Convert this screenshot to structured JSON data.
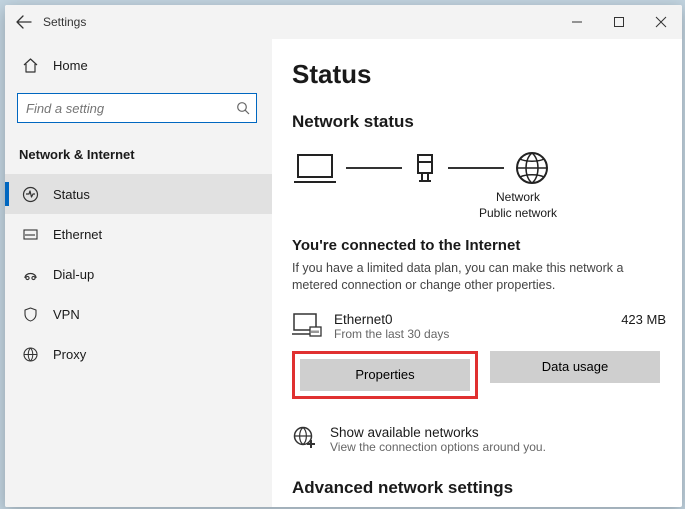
{
  "window": {
    "title": "Settings"
  },
  "sidebar": {
    "home_label": "Home",
    "search_placeholder": "Find a setting",
    "category_label": "Network & Internet",
    "items": [
      {
        "label": "Status"
      },
      {
        "label": "Ethernet"
      },
      {
        "label": "Dial-up"
      },
      {
        "label": "VPN"
      },
      {
        "label": "Proxy"
      }
    ]
  },
  "content": {
    "page_title": "Status",
    "section_title": "Network status",
    "diagram": {
      "label_line1": "Network",
      "label_line2": "Public network"
    },
    "connected_heading": "You're connected to the Internet",
    "connected_body": "If you have a limited data plan, you can make this network a metered connection or change other properties.",
    "adapter": {
      "name": "Ethernet0",
      "subtitle": "From the last 30 days",
      "usage": "423 MB"
    },
    "buttons": {
      "properties": "Properties",
      "data_usage": "Data usage"
    },
    "available": {
      "title": "Show available networks",
      "subtitle": "View the connection options around you."
    },
    "advanced_heading": "Advanced network settings"
  }
}
